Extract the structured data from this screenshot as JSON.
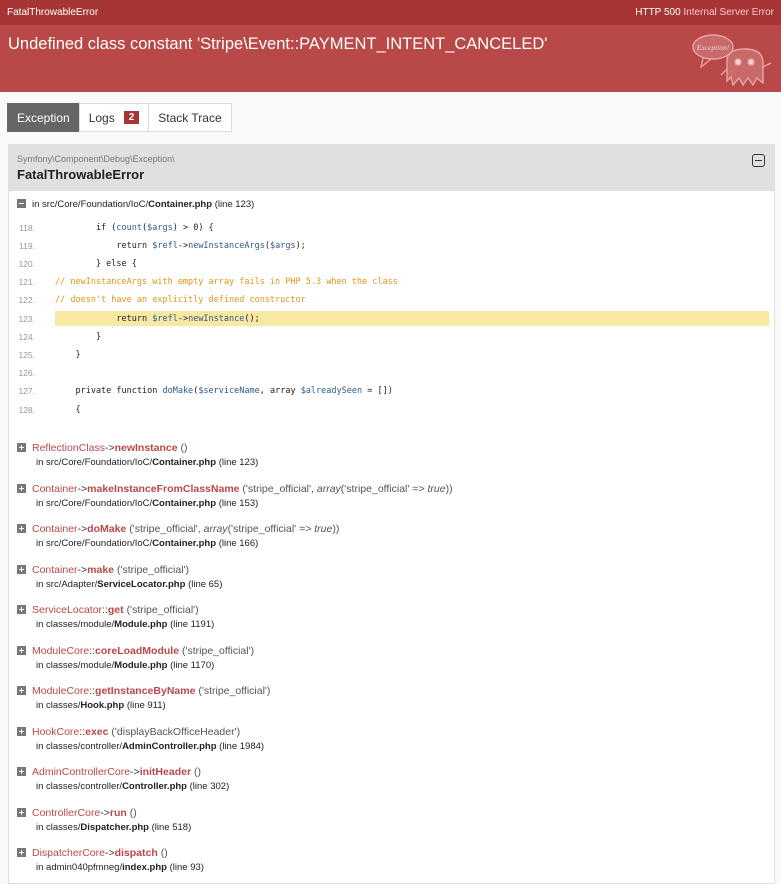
{
  "topbar": {
    "title": "FatalThrowableError",
    "status_code": "HTTP 500",
    "status_text": "Internal Server Error"
  },
  "header": {
    "message": "Undefined class constant 'Stripe\\Event::PAYMENT_INTENT_CANCELED'",
    "logo_text": "Exception!"
  },
  "tabs": [
    {
      "label": "Exception"
    },
    {
      "label": "Logs",
      "count": "2"
    },
    {
      "label": "Stack Trace"
    }
  ],
  "exception": {
    "namespace": "Symfony\\Component\\Debug\\Exception\\",
    "class": "FatalThrowableError",
    "location": {
      "prefix": "in src/Core/Foundation/IoC/",
      "file": "Container.php",
      "line": "(line 123)"
    }
  },
  "code_lines": [
    {
      "num": "118.",
      "text": "        if (count($args) > 0) {"
    },
    {
      "num": "119.",
      "text": "            return $refl->newInstanceArgs($args);"
    },
    {
      "num": "120.",
      "text": "        } else {"
    },
    {
      "num": "121.",
      "text": "            // newInstanceArgs with empty array fails in PHP 5.3 when the class"
    },
    {
      "num": "122.",
      "text": "            // doesn't have an explicitly defined constructor"
    },
    {
      "num": "123.",
      "text": "            return $refl->newInstance();"
    },
    {
      "num": "124.",
      "text": "        }"
    },
    {
      "num": "125.",
      "text": "    }"
    },
    {
      "num": "126.",
      "text": ""
    },
    {
      "num": "127.",
      "text": "    private function doMake($serviceName, array $alreadySeen = [])"
    },
    {
      "num": "128.",
      "text": "    {"
    }
  ],
  "highlight_line": "123.",
  "frames": [
    {
      "class": "ReflectionClass",
      "sep": "->",
      "fn": "newInstance",
      "args": "()",
      "loc_prefix": "in src/Core/Foundation/IoC/",
      "file": "Container.php",
      "line": "(line 123)"
    },
    {
      "class": "Container",
      "sep": "->",
      "fn": "makeInstanceFromClassName",
      "args": "('stripe_official', <i>array</i>('stripe_official' => <i>true</i>))",
      "loc_prefix": "in src/Core/Foundation/IoC/",
      "file": "Container.php",
      "line": "(line 153)"
    },
    {
      "class": "Container",
      "sep": "->",
      "fn": "doMake",
      "args": "('stripe_official', <i>array</i>('stripe_official' => <i>true</i>))",
      "loc_prefix": "in src/Core/Foundation/IoC/",
      "file": "Container.php",
      "line": "(line 166)"
    },
    {
      "class": "Container",
      "sep": "->",
      "fn": "make",
      "args": "('stripe_official')",
      "loc_prefix": "in src/Adapter/",
      "file": "ServiceLocator.php",
      "line": "(line 65)"
    },
    {
      "class": "ServiceLocator",
      "sep": "::",
      "fn": "get",
      "args": "('stripe_official')",
      "loc_prefix": "in classes/module/",
      "file": "Module.php",
      "line": "(line 1191)"
    },
    {
      "class": "ModuleCore",
      "sep": "::",
      "fn": "coreLoadModule",
      "args": "('stripe_official')",
      "loc_prefix": "in classes/module/",
      "file": "Module.php",
      "line": "(line 1170)"
    },
    {
      "class": "ModuleCore",
      "sep": "::",
      "fn": "getInstanceByName",
      "args": "('stripe_official')",
      "loc_prefix": "in classes/",
      "file": "Hook.php",
      "line": "(line 911)"
    },
    {
      "class": "HookCore",
      "sep": "::",
      "fn": "exec",
      "args": "('displayBackOfficeHeader')",
      "loc_prefix": "in classes/controller/",
      "file": "AdminController.php",
      "line": "(line 1984)"
    },
    {
      "class": "AdminControllerCore",
      "sep": "->",
      "fn": "initHeader",
      "args": "()",
      "loc_prefix": "in classes/controller/",
      "file": "Controller.php",
      "line": "(line 302)"
    },
    {
      "class": "ControllerCore",
      "sep": "->",
      "fn": "run",
      "args": "()",
      "loc_prefix": "in classes/",
      "file": "Dispatcher.php",
      "line": "(line 518)"
    },
    {
      "class": "DispatcherCore",
      "sep": "->",
      "fn": "dispatch",
      "args": "()",
      "loc_prefix": "in admin040pfmneg/",
      "file": "index.php",
      "line": "(line 93)"
    }
  ],
  "colors": {
    "brand_dark": "#a73535",
    "brand": "#b94848",
    "highlight": "#f7e8a3",
    "comment": "#e6941a",
    "variable": "#2d5c8b"
  }
}
